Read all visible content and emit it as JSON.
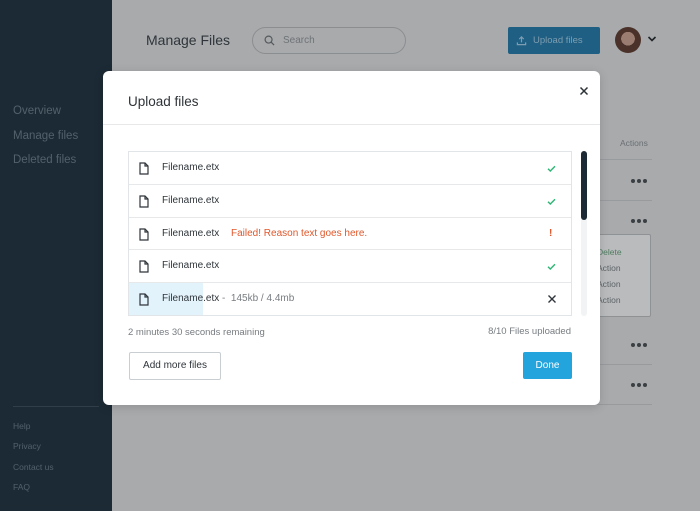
{
  "sidebar": {
    "nav": [
      {
        "label": "Overview"
      },
      {
        "label": "Manage files"
      },
      {
        "label": "Deleted files"
      }
    ],
    "footer": [
      {
        "label": "Help"
      },
      {
        "label": "Privacy"
      },
      {
        "label": "Contact us"
      },
      {
        "label": "FAQ"
      }
    ]
  },
  "header": {
    "title": "Manage Files",
    "search_placeholder": "Search",
    "upload_label": "Upload files"
  },
  "table": {
    "actions_header": "Actions",
    "context_menu": [
      "Delete",
      "Action",
      "Action",
      "Action"
    ]
  },
  "modal": {
    "title": "Upload files",
    "files": [
      {
        "name": "Filename.etx",
        "status": "done"
      },
      {
        "name": "Filename.etx",
        "status": "done"
      },
      {
        "name": "Filename.etx",
        "status": "failed",
        "error": "Failed! Reason text goes here.",
        "error_mark": "!"
      },
      {
        "name": "Filename.etx",
        "status": "done"
      },
      {
        "name": "Filename.etx",
        "status": "uploading",
        "separator": "-",
        "size": "145kb / 4.4mb",
        "progress": 0.033
      }
    ],
    "time_remaining": "2 minutes 30 seconds remaining",
    "files_count": "8/10 Files uploaded",
    "add_more_label": "Add more files",
    "done_label": "Done"
  },
  "colors": {
    "accent": "#23a4dc",
    "success": "#2bb673",
    "error": "#e0572b",
    "sidebar_bg": "#1c2a35"
  }
}
